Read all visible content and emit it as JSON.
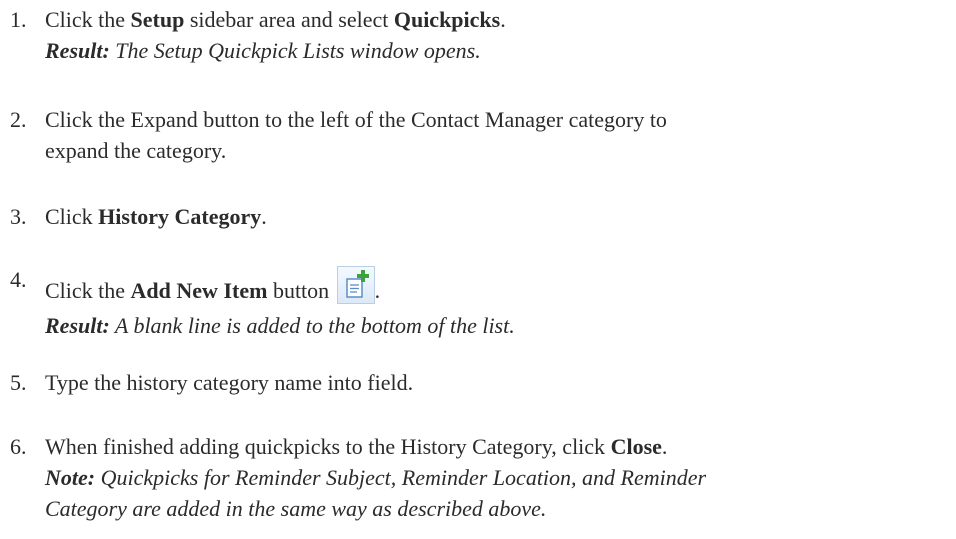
{
  "steps": [
    {
      "number": "1.",
      "t1": "Click the ",
      "b1": "Setup",
      "t2": " sidebar area and select ",
      "b2": "Quickpicks",
      "t3": ".",
      "result_label": "Result:",
      "result_text": " The Setup Quickpick Lists window opens."
    },
    {
      "number": "2.",
      "line1": "Click the Expand button to the left of the Contact Manager category to",
      "line2": "expand the category."
    },
    {
      "number": "3.",
      "t1": "Click ",
      "b1": "History Category",
      "t2": "."
    },
    {
      "number": "4.",
      "t1": "Click the ",
      "b1": "Add New Item",
      "t2": " button ",
      "t3": ".",
      "icon": "add-new-item-icon",
      "result_label": "Result:",
      "result_text": " A blank line is added to the bottom of the list."
    },
    {
      "number": "5.",
      "line1": "Type the history category name into field."
    },
    {
      "number": "6.",
      "t1": "When finished adding quickpicks to the History Category, click ",
      "b1": "Close",
      "t2": ".",
      "note_label": "Note:",
      "note_line1": " Quickpicks for Reminder Subject, Reminder Location, and Reminder",
      "note_line2": "Category are added in the same way as described above."
    }
  ],
  "colors": {
    "text": "#2b2b2b",
    "icon_plus": "#3aa33a",
    "icon_border": "#b8cfe6"
  }
}
